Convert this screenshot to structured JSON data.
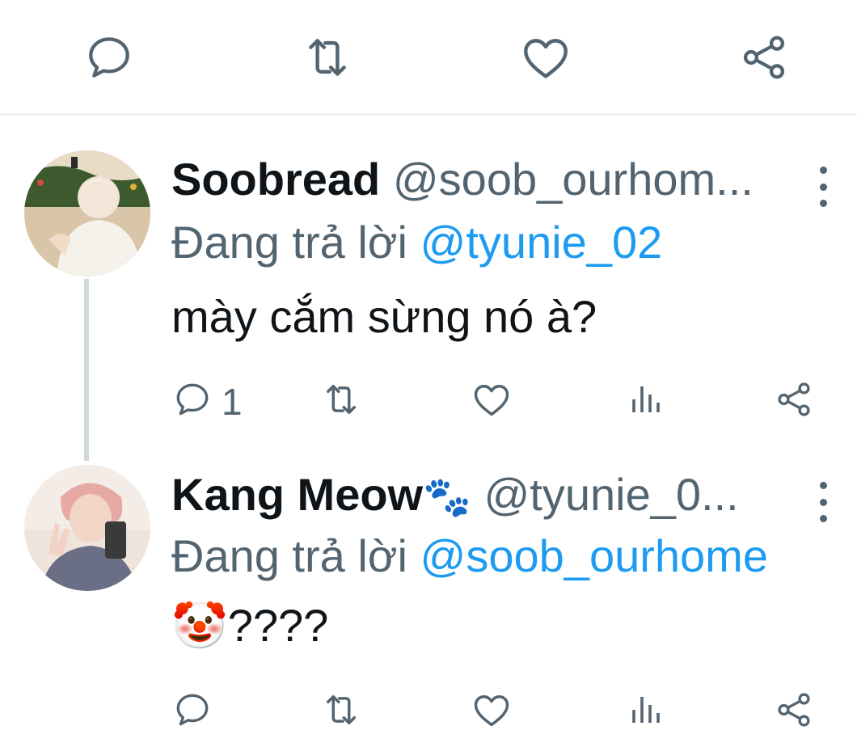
{
  "colors": {
    "icon": "#536471",
    "mention": "#1d9bf0",
    "text": "#0f1419",
    "divider": "#eff3f4",
    "thread_line": "#cfd9de"
  },
  "top_actions": {
    "icons": [
      "reply-icon",
      "retweet-icon",
      "like-icon",
      "share-icon"
    ]
  },
  "tweets": [
    {
      "name": "Soobread",
      "handle": "@soob_ourhom...",
      "reply_prefix": "Đang trả lời",
      "reply_to": "@tyunie_02",
      "text": "mày cắm sừng nó à?",
      "reply_count": "1",
      "icons": [
        "reply-icon",
        "retweet-icon",
        "like-icon",
        "analytics-icon",
        "share-icon"
      ]
    },
    {
      "name": "Kang Meow",
      "name_emoji": "🐾",
      "handle": "@tyunie_0...",
      "reply_prefix": "Đang trả lời",
      "reply_to": "@soob_ourhome",
      "text_emoji": "🤡",
      "text": "????",
      "icons": [
        "reply-icon",
        "retweet-icon",
        "like-icon",
        "analytics-icon",
        "share-icon"
      ]
    }
  ]
}
